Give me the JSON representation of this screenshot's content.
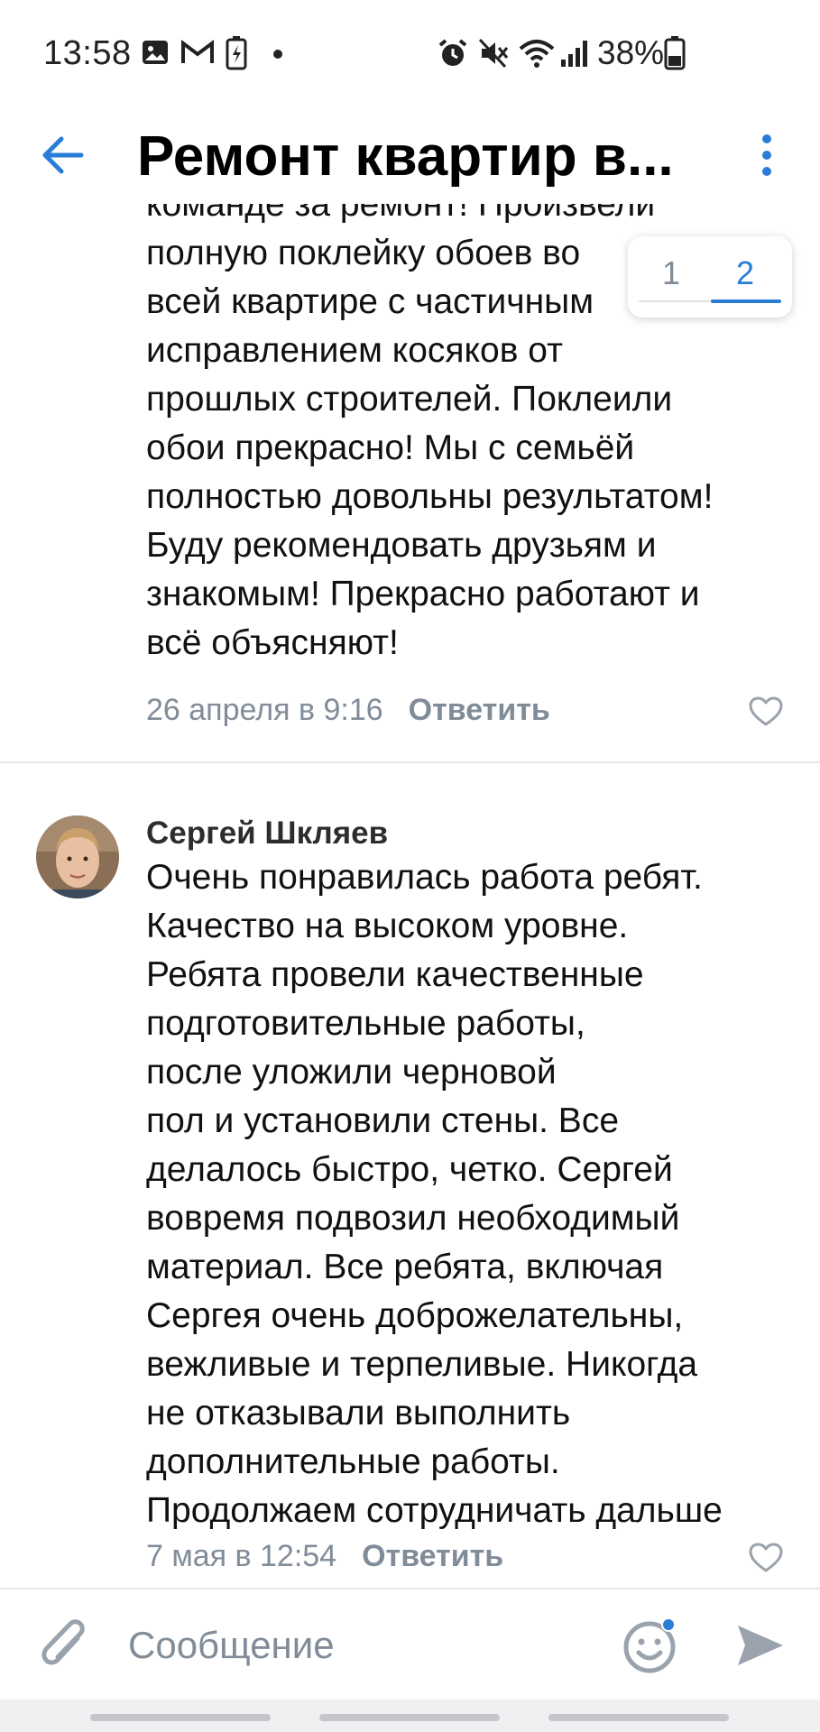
{
  "status_bar": {
    "time": "13:58",
    "battery_percent": "38%",
    "icons": [
      "image-icon",
      "gmail-icon",
      "battery-charging-icon",
      "dot-icon",
      "alarm-icon",
      "mute-icon",
      "wifi-icon",
      "signal-icon",
      "battery-icon"
    ]
  },
  "header": {
    "title": "Ремонт квартир в...",
    "back_icon": "arrow-left-icon",
    "menu_icon": "more-vertical-icon"
  },
  "page_switch": {
    "pages": [
      "1",
      "2"
    ],
    "active": "2"
  },
  "comments": [
    {
      "text_lines": [
        "команде за ремонт! Произвели",
        "полную поклейку обоев во",
        "всей квартире с частичным",
        "исправлением косяков от",
        "прошлых строителей. Поклеили",
        "обои прекрасно! Мы с семьёй",
        "полностью довольны результатом!",
        "Буду рекомендовать друзьям и",
        "знакомым! Прекрасно работают и",
        "всё объясняют!"
      ],
      "date": "26 апреля в 9:16",
      "reply_label": "Ответить"
    },
    {
      "author": "Сергей Шкляев",
      "text_lines": [
        "Очень понравилась работа ребят.",
        "Качество на высоком уровне.",
        "Ребята провели качественные",
        "подготовительные работы,",
        "после уложили черновой",
        "пол и установили стены. Все",
        "делалось быстро, четко. Сергей",
        "вовремя подвозил необходимый",
        "материал.  Все ребята, включая",
        "Сергея очень доброжелательны,",
        "вежливые и терпеливые. Никогда",
        "не отказывали выполнить",
        "дополнительные работы.",
        "Продолжаем сотрудничать дальше"
      ],
      "date": "7 мая в 12:54",
      "reply_label": "Ответить"
    }
  ],
  "composer": {
    "placeholder": "Сообщение",
    "value": ""
  },
  "colors": {
    "accent": "#2a7dd6",
    "secondary_text": "#818c99",
    "divider": "#e7e8ec"
  }
}
